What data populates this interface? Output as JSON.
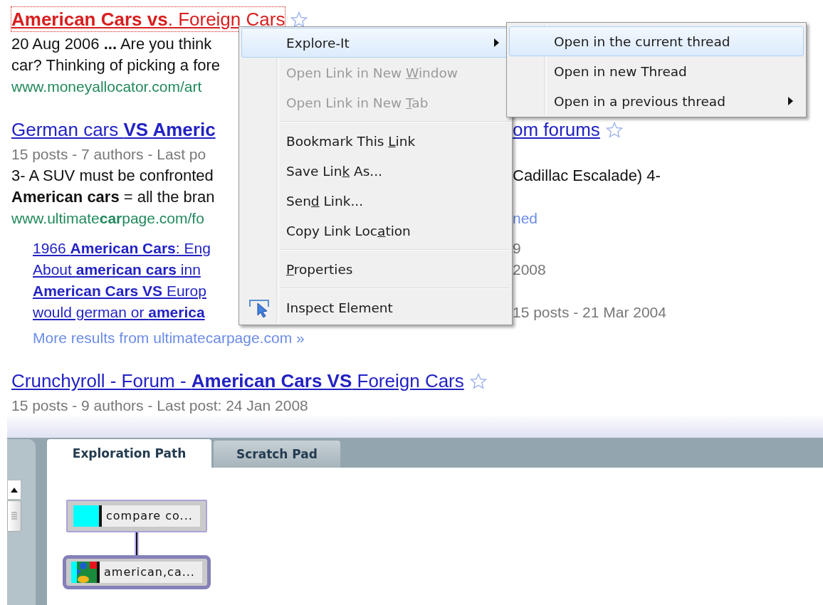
{
  "results": [
    {
      "kind": "title",
      "text": "**American Cars vs**. Foreign Cars",
      "focused": true,
      "star": true
    },
    {
      "kind": "snippet",
      "text": "20 Aug 2006 **...** Are you think"
    },
    {
      "kind": "snippet",
      "text": "car? Thinking of picking a fore"
    },
    {
      "kind": "url",
      "text": "www.moneyallocator.com/art"
    },
    {
      "kind": "title",
      "text": "German cars **VS Americ**",
      "focused": false,
      "star": true,
      "right": {
        "kind": "title",
        "text": "om forums"
      }
    },
    {
      "kind": "meta",
      "text": "15 posts - 7 authors - Last po"
    },
    {
      "kind": "snippet",
      "text": "3- A SUV must be confronted",
      "right": {
        "kind": "snippet",
        "text": "Cadillac Escalade) 4-"
      }
    },
    {
      "kind": "snippet",
      "text": "**American cars** = all the bran"
    },
    {
      "kind": "url",
      "text": "www.ultimate**car**page.com/fo",
      "right": {
        "kind": "action",
        "text": "ned"
      }
    },
    {
      "kind": "sublink",
      "text": "1966 **American Cars**: Eng",
      "right": {
        "kind": "meta",
        "text": "9"
      }
    },
    {
      "kind": "sublink",
      "text": "About **american cars** inn",
      "right": {
        "kind": "meta",
        "text": "2008"
      }
    },
    {
      "kind": "sublink",
      "text": "**American Cars VS** Europ"
    },
    {
      "kind": "sublink",
      "text": "would german or **america**",
      "right": {
        "kind": "meta",
        "text": "15 posts - 21 Mar 2004"
      }
    },
    {
      "kind": "more",
      "text": "More results from ultimatecarpage.com »"
    },
    {
      "kind": "title",
      "text": "Crunchyroll - Forum - **American Cars VS** Foreign Cars",
      "focused": false,
      "star": true
    },
    {
      "kind": "meta",
      "text": "15 posts - 9 authors - Last post: 24 Jan 2008"
    }
  ],
  "context_menu": {
    "items": [
      {
        "kind": "item",
        "label": [
          {
            "text": "Explore-It",
            "underline": false
          }
        ],
        "selected": true,
        "disabled": false,
        "submenu": true,
        "has_icon": false
      },
      {
        "kind": "item",
        "label": [
          {
            "text": "Open Link in New ",
            "underline": false
          },
          {
            "text": "W",
            "underline": true
          },
          {
            "text": "indow",
            "underline": false
          }
        ],
        "selected": false,
        "disabled": true,
        "submenu": false,
        "has_icon": false
      },
      {
        "kind": "item",
        "label": [
          {
            "text": "Open Link in New ",
            "underline": false
          },
          {
            "text": "T",
            "underline": true
          },
          {
            "text": "ab",
            "underline": false
          }
        ],
        "selected": false,
        "disabled": true,
        "submenu": false,
        "has_icon": false
      },
      {
        "kind": "separator"
      },
      {
        "kind": "item",
        "label": [
          {
            "text": "Bookmark This ",
            "underline": false
          },
          {
            "text": "L",
            "underline": true
          },
          {
            "text": "ink",
            "underline": false
          }
        ],
        "selected": false,
        "disabled": false,
        "submenu": false,
        "has_icon": false
      },
      {
        "kind": "item",
        "label": [
          {
            "text": "Save Lin",
            "underline": false
          },
          {
            "text": "k",
            "underline": true
          },
          {
            "text": " As...",
            "underline": false
          }
        ],
        "selected": false,
        "disabled": false,
        "submenu": false,
        "has_icon": false
      },
      {
        "kind": "item",
        "label": [
          {
            "text": "Sen",
            "underline": false
          },
          {
            "text": "d",
            "underline": true
          },
          {
            "text": " Link...",
            "underline": false
          }
        ],
        "selected": false,
        "disabled": false,
        "submenu": false,
        "has_icon": false
      },
      {
        "kind": "item",
        "label": [
          {
            "text": "Copy Link Loc",
            "underline": false
          },
          {
            "text": "a",
            "underline": true
          },
          {
            "text": "tion",
            "underline": false
          }
        ],
        "selected": false,
        "disabled": false,
        "submenu": false,
        "has_icon": false
      },
      {
        "kind": "separator"
      },
      {
        "kind": "item",
        "label": [
          {
            "text": "P",
            "underline": true
          },
          {
            "text": "roperties",
            "underline": false
          }
        ],
        "selected": false,
        "disabled": false,
        "submenu": false,
        "has_icon": false
      },
      {
        "kind": "separator"
      },
      {
        "kind": "item",
        "label": [
          {
            "text": "Inspect Element",
            "underline": false
          }
        ],
        "selected": false,
        "disabled": false,
        "submenu": false,
        "has_icon": true
      }
    ]
  },
  "submenu": {
    "items": [
      {
        "label": "Open in the current thread",
        "selected": true,
        "submenu": false
      },
      {
        "label": "Open in new Thread",
        "selected": false,
        "submenu": false
      },
      {
        "label": "Open in a previous thread",
        "selected": false,
        "submenu": true
      }
    ]
  },
  "panel": {
    "tabs": [
      {
        "label": "Exploration Path",
        "selected": true
      },
      {
        "label": "Scratch Pad",
        "selected": false
      }
    ],
    "nodes": [
      {
        "label": "compare co...",
        "kind": "swatch",
        "selected": false
      },
      {
        "label": "american,ca...",
        "kind": "search",
        "selected": true
      }
    ]
  }
}
